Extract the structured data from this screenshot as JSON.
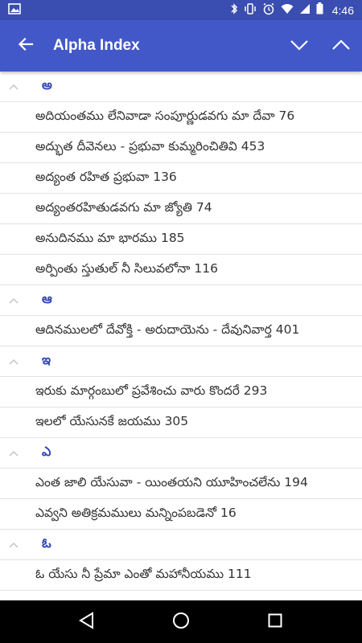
{
  "status": {
    "time": "4:46",
    "icons": [
      "image-icon",
      "bluetooth-icon",
      "vibrate-icon",
      "alarm-icon",
      "wifi-icon",
      "signal-icon",
      "battery-icon"
    ]
  },
  "appbar": {
    "title": "Alpha Index",
    "back_icon": "arrow-left-icon",
    "collapse_icon": "chevron-down-icon",
    "expand_icon": "chevron-up-icon"
  },
  "colors": {
    "appbar": "#4358c8",
    "statusbar": "#3a4db0",
    "letter": "#3347b8",
    "text": "#333333"
  },
  "groups": [
    {
      "letter": "అ",
      "items": [
        "అదియంతము లేనివాడా సంపూర్ణుడవగు మా దేవా 76",
        "అద్భుత దీవెనలు - ప్రభువా కుమ్మరించితివి 453",
        "అద్యంత రహిత ప్రభువా 136",
        "అద్యంతరహితుడవగు మా జ్యోతి 74",
        "అనుదినము మా భారము 185",
        "అర్పింతు స్తుతుల్ నీ సిలువలోనా 116"
      ]
    },
    {
      "letter": "ఆ",
      "items": [
        "ఆదినములలో దేవోక్తి - అరుదాయెను - దేవునివార్త 401"
      ]
    },
    {
      "letter": "ఇ",
      "items": [
        "ఇరుకు మార్గంబులో ప్రవేశించు వారు కొందరే 293",
        "ఇలలో యేసునకే జయము 305"
      ]
    },
    {
      "letter": "ఎ",
      "items": [
        "ఎంత జాలి యేసువా - యింతయని యూహించలేను 194",
        "ఎవ్వని అతిక్రమములు మన్నింపబడెనో 16"
      ]
    },
    {
      "letter": "ఓ",
      "items": [
        "ఓ యేసు నీ ప్రేమా ఎంతో మహానీయము 111"
      ]
    }
  ],
  "navbar": {
    "back_icon": "nav-back-icon",
    "home_icon": "nav-home-icon",
    "recents_icon": "nav-recents-icon"
  }
}
